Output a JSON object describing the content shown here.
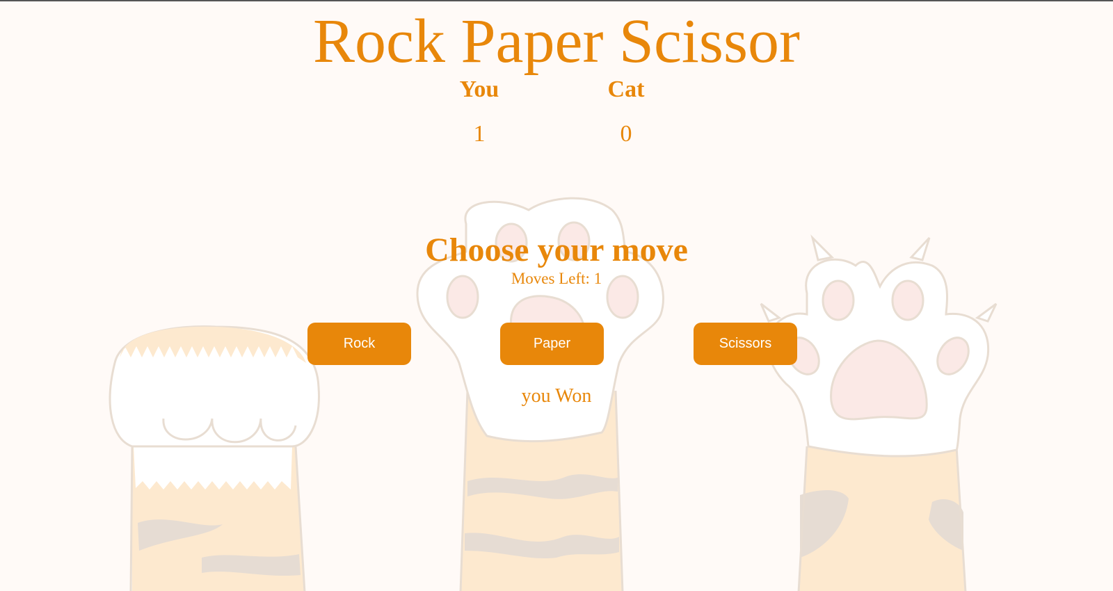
{
  "title": "Rock Paper Scissor",
  "scoreboard": {
    "player_label": "You",
    "cat_label": "Cat",
    "player_score": "1",
    "cat_score": "0"
  },
  "prompt": "Choose your move",
  "moves_left": "Moves Left: 1",
  "buttons": {
    "rock": "Rock",
    "paper": "Paper",
    "scissors": "Scissors"
  },
  "result": "you Won",
  "colors": {
    "accent": "#e8870a",
    "background": "#fffaf7",
    "paw_fur": "#fde9cf",
    "paw_white": "#ffffff",
    "paw_pad": "#fbe9e6",
    "paw_outline": "#e8ddd2",
    "paw_stripe": "#e6dcd3"
  },
  "background_art": [
    "cat-paw-fist-illustration",
    "cat-paw-open-illustration",
    "cat-paw-claws-illustration"
  ]
}
